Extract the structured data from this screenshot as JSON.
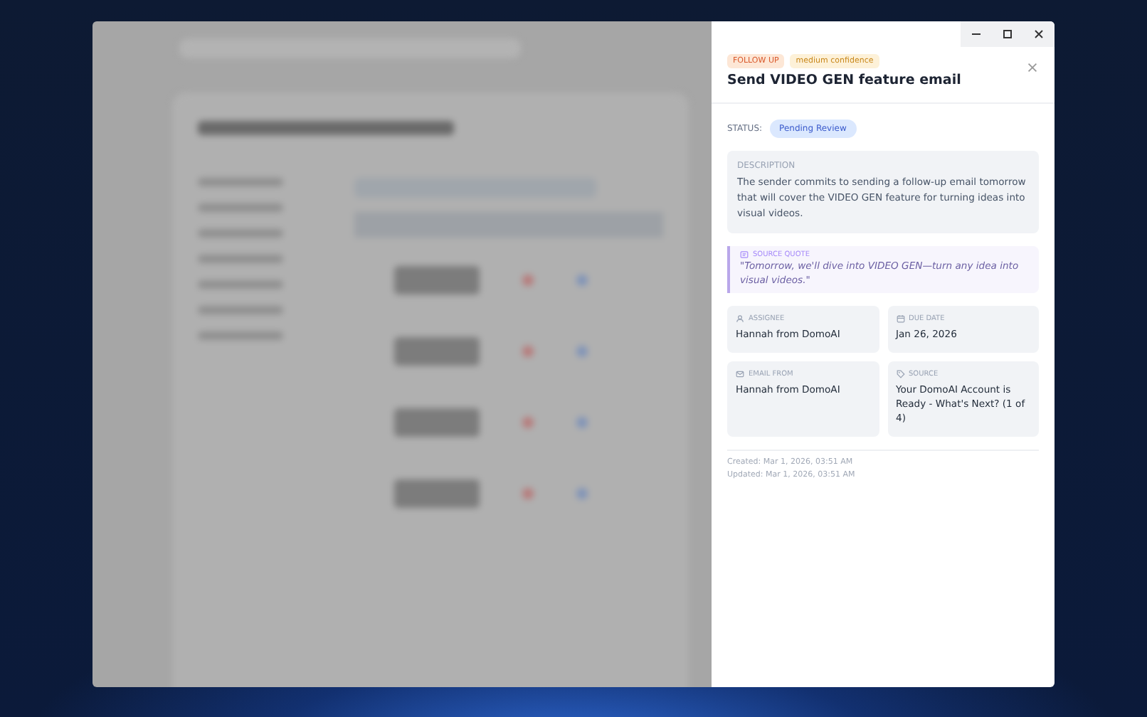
{
  "panel": {
    "tags": [
      {
        "label": "FOLLOW UP",
        "kind": "type"
      },
      {
        "label": "medium confidence",
        "kind": "confidence"
      }
    ],
    "title": "Send VIDEO GEN feature email",
    "status_label": "STATUS:",
    "status": "Pending Review",
    "description": {
      "label": "DESCRIPTION",
      "text": "The sender commits to sending a follow-up email tomorrow that will cover the VIDEO GEN feature for turning ideas into visual videos."
    },
    "source_quote": {
      "label": "SOURCE QUOTE",
      "text": "\"Tomorrow, we'll dive into VIDEO GEN—turn any idea into visual videos.\""
    },
    "fields": [
      {
        "kind": "person",
        "label": "ASSIGNEE",
        "value": "Hannah from DomoAI"
      },
      {
        "kind": "calendar",
        "label": "DUE DATE",
        "value": "Jan 26, 2026"
      },
      {
        "kind": "mail",
        "label": "EMAIL FROM",
        "value": "Hannah from DomoAI"
      },
      {
        "kind": "tag",
        "label": "SOURCE",
        "value": "Your DomoAI Account is Ready - What's Next? (1 of 4)"
      }
    ],
    "created": "Created: Mar 1, 2026, 03:51 AM",
    "updated": "Updated: Mar 1, 2026, 03:51 AM"
  }
}
